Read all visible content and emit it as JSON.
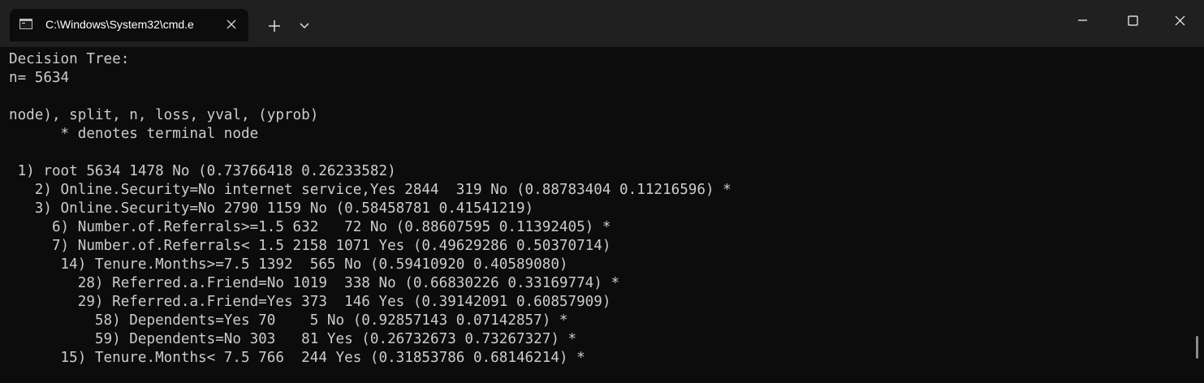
{
  "window": {
    "tab_title": "C:\\Windows\\System32\\cmd.e",
    "icons": {
      "tab": "terminal-icon",
      "tab_close": "close-icon",
      "new_tab": "plus-icon",
      "dropdown": "chevron-down-icon",
      "minimize": "minimize-icon",
      "maximize": "maximize-icon",
      "close": "close-icon"
    }
  },
  "console": {
    "lines": [
      "Decision Tree:",
      "n= 5634",
      "",
      "node), split, n, loss, yval, (yprob)",
      "      * denotes terminal node",
      "",
      " 1) root 5634 1478 No (0.73766418 0.26233582)",
      "   2) Online.Security=No internet service,Yes 2844  319 No (0.88783404 0.11216596) *",
      "   3) Online.Security=No 2790 1159 No (0.58458781 0.41541219)",
      "     6) Number.of.Referrals>=1.5 632   72 No (0.88607595 0.11392405) *",
      "     7) Number.of.Referrals< 1.5 2158 1071 Yes (0.49629286 0.50370714)",
      "      14) Tenure.Months>=7.5 1392  565 No (0.59410920 0.40589080)",
      "        28) Referred.a.Friend=No 1019  338 No (0.66830226 0.33169774) *",
      "        29) Referred.a.Friend=Yes 373  146 Yes (0.39142091 0.60857909)",
      "          58) Dependents=Yes 70    5 No (0.92857143 0.07142857) *",
      "          59) Dependents=No 303   81 Yes (0.26732673 0.73267327) *",
      "      15) Tenure.Months< 7.5 766  244 Yes (0.31853786 0.68146214) *"
    ]
  },
  "colors": {
    "titlebar": "#202020",
    "console_bg": "#0c0c0c",
    "console_text": "#cccccc"
  }
}
